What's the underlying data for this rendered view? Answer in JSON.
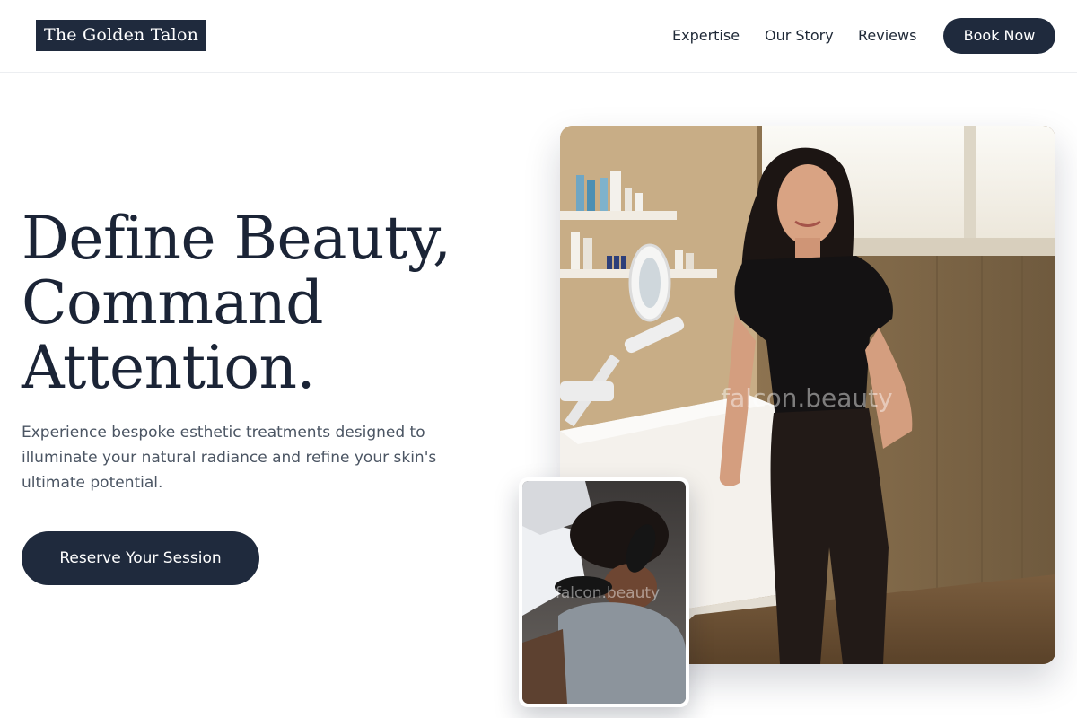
{
  "header": {
    "logo_text": "The Golden Talon",
    "nav": {
      "expertise": "Expertise",
      "story": "Our Story",
      "reviews": "Reviews"
    },
    "book_button": "Book Now"
  },
  "hero": {
    "headline_lines": [
      "Define Beauty,",
      "Command",
      "Attention."
    ],
    "subtext": "Experience bespoke esthetic treatments designed to illuminate your natural radiance and refine your skin's ultimate potential.",
    "cta_button": "Reserve Your Session"
  },
  "images": {
    "main_watermark": "falcon.beauty",
    "inset_watermark": "falcon.beauty"
  }
}
